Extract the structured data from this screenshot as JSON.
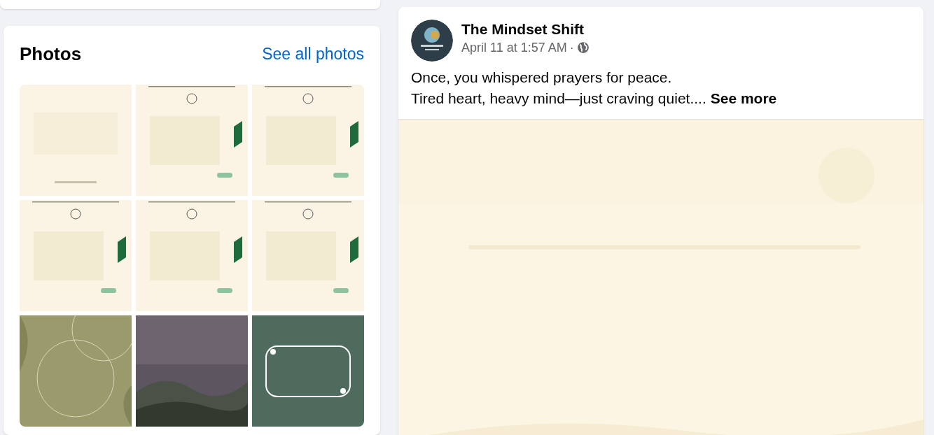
{
  "photos_card": {
    "title": "Photos",
    "see_all": "See all photos"
  },
  "post": {
    "author": "The Mindset Shift",
    "time": "April 11 at 1:57 AM",
    "separator": "·",
    "lines": [
      "Once, you whispered prayers for peace.",
      "Tired heart, heavy mind—just craving quiet...."
    ],
    "see_more": "See more"
  }
}
